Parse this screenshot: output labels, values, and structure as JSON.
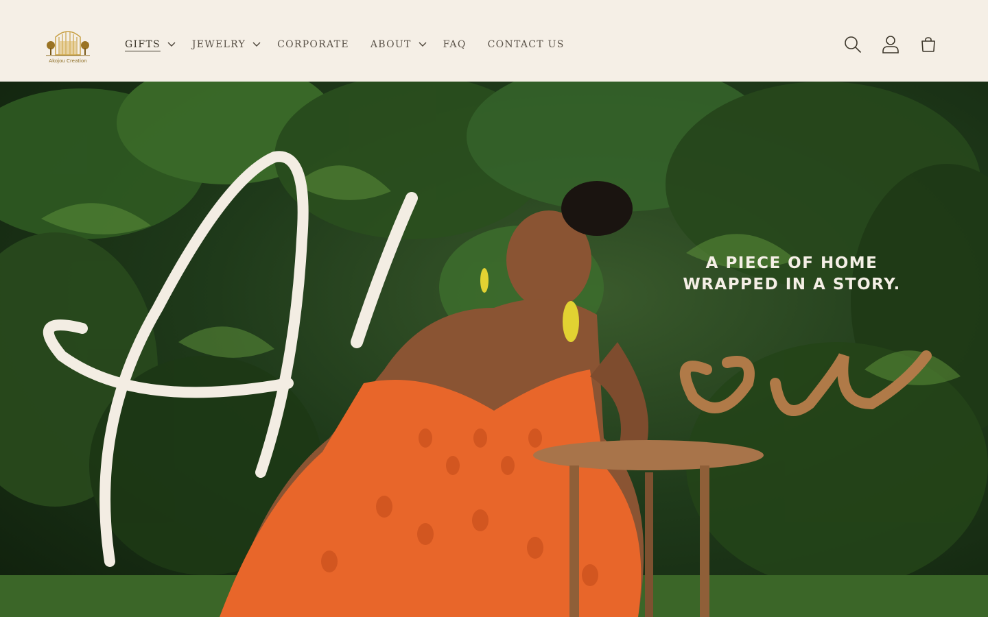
{
  "brand": {
    "logo_text": "Akojou Creation"
  },
  "nav": {
    "items": [
      {
        "label": "GIFTS",
        "has_dropdown": true,
        "active": true
      },
      {
        "label": "JEWELRY",
        "has_dropdown": true,
        "active": false
      },
      {
        "label": "CORPORATE",
        "has_dropdown": false,
        "active": false
      },
      {
        "label": "ABOUT",
        "has_dropdown": true,
        "active": false
      },
      {
        "label": "FAQ",
        "has_dropdown": false,
        "active": false
      },
      {
        "label": "CONTACT US",
        "has_dropdown": false,
        "active": false
      }
    ]
  },
  "header_icons": [
    "search-icon",
    "account-icon",
    "cart-icon"
  ],
  "hero": {
    "tagline_line1": "A PIECE OF HOME",
    "tagline_line2": "WRAPPED IN A STORY.",
    "script_wordmark": "Akojou"
  },
  "colors": {
    "header_bg": "#f5efe6",
    "nav_text": "#5a5248",
    "hero_foliage": "#1f3a1a",
    "dress": "#e8662a",
    "script_cream": "#f3ede3",
    "wood": "#a8744a"
  }
}
